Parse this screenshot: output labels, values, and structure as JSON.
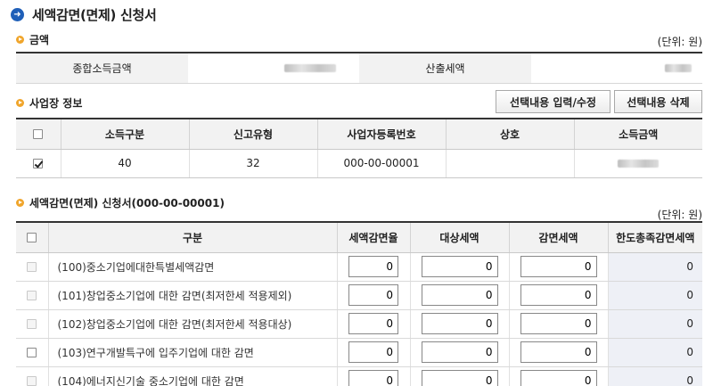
{
  "page": {
    "title": "세액감면(면제) 신청서"
  },
  "amount_section": {
    "title": "금액",
    "unit": "(단위: 원)",
    "total_income_label": "종합소득금액",
    "calculated_tax_label": "산출세액"
  },
  "business_section": {
    "title": "사업장 정보",
    "input_button": "선택내용 입력/수정",
    "delete_button": "선택내용 삭제",
    "columns": [
      "소득구분",
      "신고유형",
      "사업자등록번호",
      "상호",
      "소득금액"
    ],
    "rows": [
      {
        "checked": true,
        "income_type": "40",
        "report_type": "32",
        "biz_no": "000-00-00001",
        "name": ""
      }
    ]
  },
  "reduction_section": {
    "title": "세액감면(면제) 신청서(000-00-00001)",
    "unit": "(단위: 원)",
    "columns": [
      "구분",
      "세액감면율",
      "대상세액",
      "감면세액",
      "한도총족감면세액"
    ],
    "rows": [
      {
        "name": "(100)중소기업에대한특별세액감면",
        "rate": "0",
        "target": "0",
        "reduction": "0",
        "limit": "0"
      },
      {
        "name": "(101)창업중소기업에 대한 감면(최저한세 적용제외)",
        "rate": "0",
        "target": "0",
        "reduction": "0",
        "limit": "0"
      },
      {
        "name": "(102)창업중소기업에 대한 감면(최저한세 적용대상)",
        "rate": "0",
        "target": "0",
        "reduction": "0",
        "limit": "0"
      },
      {
        "name": "(103)연구개발특구에 입주기업에 대한 감면",
        "rate": "0",
        "target": "0",
        "reduction": "0",
        "limit": "0"
      },
      {
        "name": "(104)에너지신기술 중소기업에 대한 감면",
        "rate": "0",
        "target": "0",
        "reduction": "0",
        "limit": "0"
      }
    ]
  },
  "colors": {
    "title_icon": "#1f5fb8",
    "section_bullet": "#f0a52b",
    "limit_cell_bg": "#eef0f6"
  }
}
